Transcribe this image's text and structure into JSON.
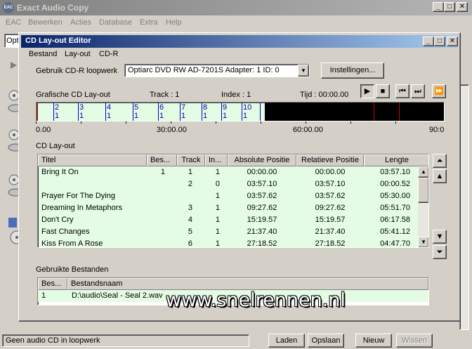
{
  "main_window": {
    "title": "Exact Audio Copy",
    "menu": [
      "EAC",
      "Bewerken",
      "Acties",
      "Database",
      "Extra",
      "Help"
    ],
    "source_select_value": "Optiarc",
    "status_text": "Geen audio CD in loopwerk",
    "buttons": {
      "load": "Laden",
      "save": "Opslaan",
      "new": "Nieuw",
      "clear": "Wissen"
    }
  },
  "dialog": {
    "title": "CD Lay-out Editor",
    "menu": [
      "Bestand",
      "Lay-out",
      "CD-R"
    ],
    "drive_label": "Gebruik CD-R loopwerk",
    "drive_value": "Optiarc DVD RW AD-7201S   Adapter: 1  ID: 0",
    "settings_button": "Instellingen...",
    "graphic_label": "Grafische CD Lay-out",
    "track_info": "Track : 1",
    "index_info": "Index : 1",
    "time_info": "Tijd :  00:00.00",
    "timeline": {
      "markers": [
        {
          "track": "2",
          "index": "1"
        },
        {
          "track": "3",
          "index": "1"
        },
        {
          "track": "4",
          "index": "1"
        },
        {
          "track": "5",
          "index": "1"
        },
        {
          "track": "6",
          "index": "1"
        },
        {
          "track": "7",
          "index": "1"
        },
        {
          "track": "8",
          "index": "1"
        },
        {
          "track": "9",
          "index": "1"
        },
        {
          "track": "10",
          "index": "1"
        }
      ],
      "axis_labels": [
        "0.00",
        "30:00.00",
        "60:00.00",
        "90:0"
      ]
    },
    "layout_label": "CD Lay-out",
    "tracks_table": {
      "headers": [
        "Titel",
        "Bes...",
        "Track",
        "In...",
        "Absolute Positie",
        "Relatieve Positie",
        "Lengte"
      ],
      "rows": [
        [
          "Bring It On",
          "1",
          "1",
          "1",
          "00:00.00",
          "00:00.00",
          "03:57.10"
        ],
        [
          "",
          "",
          "2",
          "0",
          "03:57.10",
          "03:57.10",
          "00:00.52"
        ],
        [
          "Prayer For The Dying",
          "",
          "",
          "1",
          "03:57.62",
          "03:57.62",
          "05:30.00"
        ],
        [
          "Dreaming In Metaphors",
          "",
          "3",
          "1",
          "09:27.62",
          "09:27.62",
          "05:51.70"
        ],
        [
          "Don't Cry",
          "",
          "4",
          "1",
          "15:19.57",
          "15:19.57",
          "06:17.58"
        ],
        [
          "Fast Changes",
          "",
          "5",
          "1",
          "21:37.40",
          "21:37.40",
          "05:41.12"
        ],
        [
          "Kiss From A Rose",
          "",
          "6",
          "1",
          "27:18.52",
          "27:18.52",
          "04:47.70"
        ]
      ]
    },
    "files_label": "Gebruikte Bestanden",
    "files_table": {
      "headers": [
        "Bes...",
        "Bestandsnaam"
      ],
      "rows": [
        [
          "1",
          "D:\\audio\\Seal - Seal 2.wav"
        ]
      ]
    }
  },
  "watermark": "www.snelrennen.nl"
}
